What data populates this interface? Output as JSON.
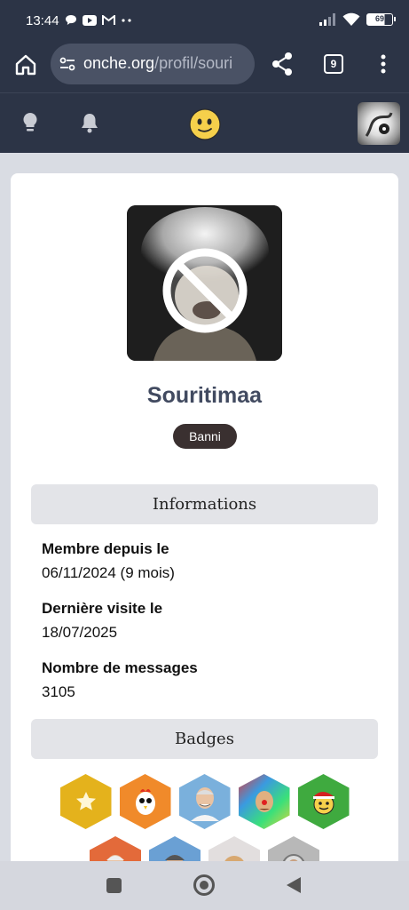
{
  "status_bar": {
    "time": "13:44",
    "battery": "69",
    "icons": [
      "chat-bubble-icon",
      "youtube-icon",
      "gmail-icon",
      "more-dots-icon",
      "signal-icon",
      "wifi-icon",
      "battery-icon"
    ]
  },
  "browser": {
    "url_domain": "onche.org",
    "url_path": "/profil/souri",
    "tab_count": "9"
  },
  "profile": {
    "username": "Souritimaa",
    "status_badge": "Banni"
  },
  "sections": {
    "informations": "Informations",
    "badges": "Badges"
  },
  "info": [
    {
      "label": "Membre depuis le",
      "value": "06/11/2024 (9 mois)"
    },
    {
      "label": "Dernière visite le",
      "value": "18/07/2025"
    },
    {
      "label": "Nombre de messages",
      "value": "3105"
    }
  ],
  "colors": {
    "header": "#2c3446",
    "accent_text": "#414a60",
    "ban_badge": "#3a3030"
  }
}
